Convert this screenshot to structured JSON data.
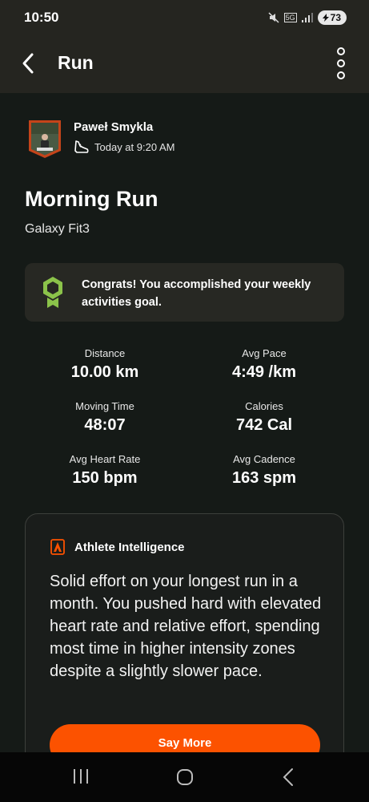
{
  "status_bar": {
    "time": "10:50",
    "network": "5G",
    "battery": "73"
  },
  "header": {
    "title": "Run",
    "back_icon": "chevron-left-icon",
    "more_icon": "more-vertical-icon"
  },
  "athlete": {
    "name": "Paweł Smykla",
    "activity_icon": "shoe-icon",
    "timestamp": "Today at 9:20 AM"
  },
  "activity": {
    "title": "Morning Run",
    "device": "Galaxy Fit3"
  },
  "congrats": {
    "icon": "badge-icon",
    "text": "Congrats! You accomplished your weekly activities goal."
  },
  "stats": [
    {
      "label": "Distance",
      "value": "10.00 km"
    },
    {
      "label": "Avg Pace",
      "value": "4:49 /km"
    },
    {
      "label": "Moving Time",
      "value": "48:07"
    },
    {
      "label": "Calories",
      "value": "742 Cal"
    },
    {
      "label": "Avg Heart Rate",
      "value": "150 bpm"
    },
    {
      "label": "Avg Cadence",
      "value": "163 spm"
    }
  ],
  "athlete_intelligence": {
    "title": "Athlete Intelligence",
    "text": "Solid effort on your longest run in a month. You pushed hard with elevated heart rate and relative effort, spending most time in higher intensity zones despite a slightly slower pace.",
    "button_label": "Say More"
  },
  "colors": {
    "brand_orange": "#fc5200",
    "badge_green": "#8bc34a",
    "background": "#151a17"
  }
}
